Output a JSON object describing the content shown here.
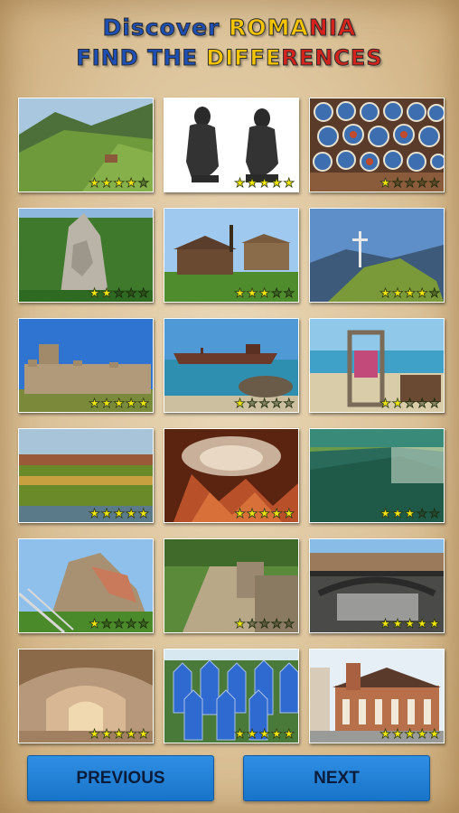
{
  "header": {
    "title_line1": [
      {
        "text": "Discover ",
        "color": "blue"
      },
      {
        "text": "ROMA",
        "color": "yellow"
      },
      {
        "text": "NIA",
        "color": "red"
      }
    ],
    "title_line2": [
      {
        "text": "FIND THE ",
        "color": "blue"
      },
      {
        "text": "DIFFE",
        "color": "yellow"
      },
      {
        "text": "RENCES",
        "color": "red"
      }
    ]
  },
  "colors": {
    "blue": "#1e4fb4",
    "yellow": "#f4c400",
    "red": "#d4231c",
    "button": "#1f7fd6",
    "star": "#f1e60a"
  },
  "levels": [
    {
      "scene": "mountain-valley",
      "stars": 4,
      "stars_max": 5
    },
    {
      "scene": "thinker-statues",
      "stars": 5,
      "stars_max": 5
    },
    {
      "scene": "ceramic-plates",
      "stars": 1,
      "stars_max": 5
    },
    {
      "scene": "rock-sculpture",
      "stars": 2,
      "stars_max": 5
    },
    {
      "scene": "village-museum",
      "stars": 3,
      "stars_max": 5
    },
    {
      "scene": "mountain-cross",
      "stars": 4,
      "stars_max": 5
    },
    {
      "scene": "fortress-ruins",
      "stars": 5,
      "stars_max": 5
    },
    {
      "scene": "shipwreck",
      "stars": 1,
      "stars_max": 5
    },
    {
      "scene": "beach-gate",
      "stars": 2,
      "stars_max": 5
    },
    {
      "scene": "riverbank",
      "stars": 5,
      "stars_max": 5
    },
    {
      "scene": "cave",
      "stars": 5,
      "stars_max": 5
    },
    {
      "scene": "salt-lake",
      "stars": 3,
      "stars_max": 5
    },
    {
      "scene": "citadel-stairs",
      "stars": 1,
      "stars_max": 5
    },
    {
      "scene": "stone-path",
      "stars": 1,
      "stars_max": 5
    },
    {
      "scene": "city-bridge",
      "stars": 5,
      "stars_max": 5
    },
    {
      "scene": "salt-mine-tunnel",
      "stars": 5,
      "stars_max": 5
    },
    {
      "scene": "merry-cemetery",
      "stars": 5,
      "stars_max": 5
    },
    {
      "scene": "church",
      "stars": 5,
      "stars_max": 5
    }
  ],
  "buttons": {
    "previous": "PREVIOUS",
    "next": "NEXT"
  }
}
